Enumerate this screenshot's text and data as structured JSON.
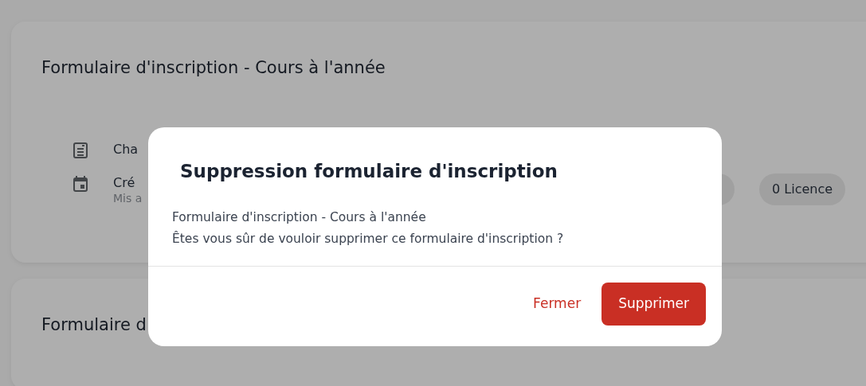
{
  "forms": [
    {
      "title": "Formulaire d'inscription - Cours à l'année",
      "rows": [
        {
          "kind": "fields",
          "label": "Cha"
        },
        {
          "kind": "date",
          "label": "Cré",
          "sublabel": "Mis a"
        }
      ],
      "chips": [
        "0 Licence"
      ]
    },
    {
      "title": "Formulaire d"
    }
  ],
  "dialog": {
    "title": "Suppression formulaire d'inscription",
    "lines": [
      "Formulaire d'inscription - Cours à l'année",
      "Êtes vous sûr de vouloir supprimer ce formulaire d'inscription ?"
    ],
    "buttons": [
      {
        "kind": "text",
        "label": "Fermer"
      },
      {
        "kind": "primary",
        "label": "Supprimer"
      }
    ]
  }
}
